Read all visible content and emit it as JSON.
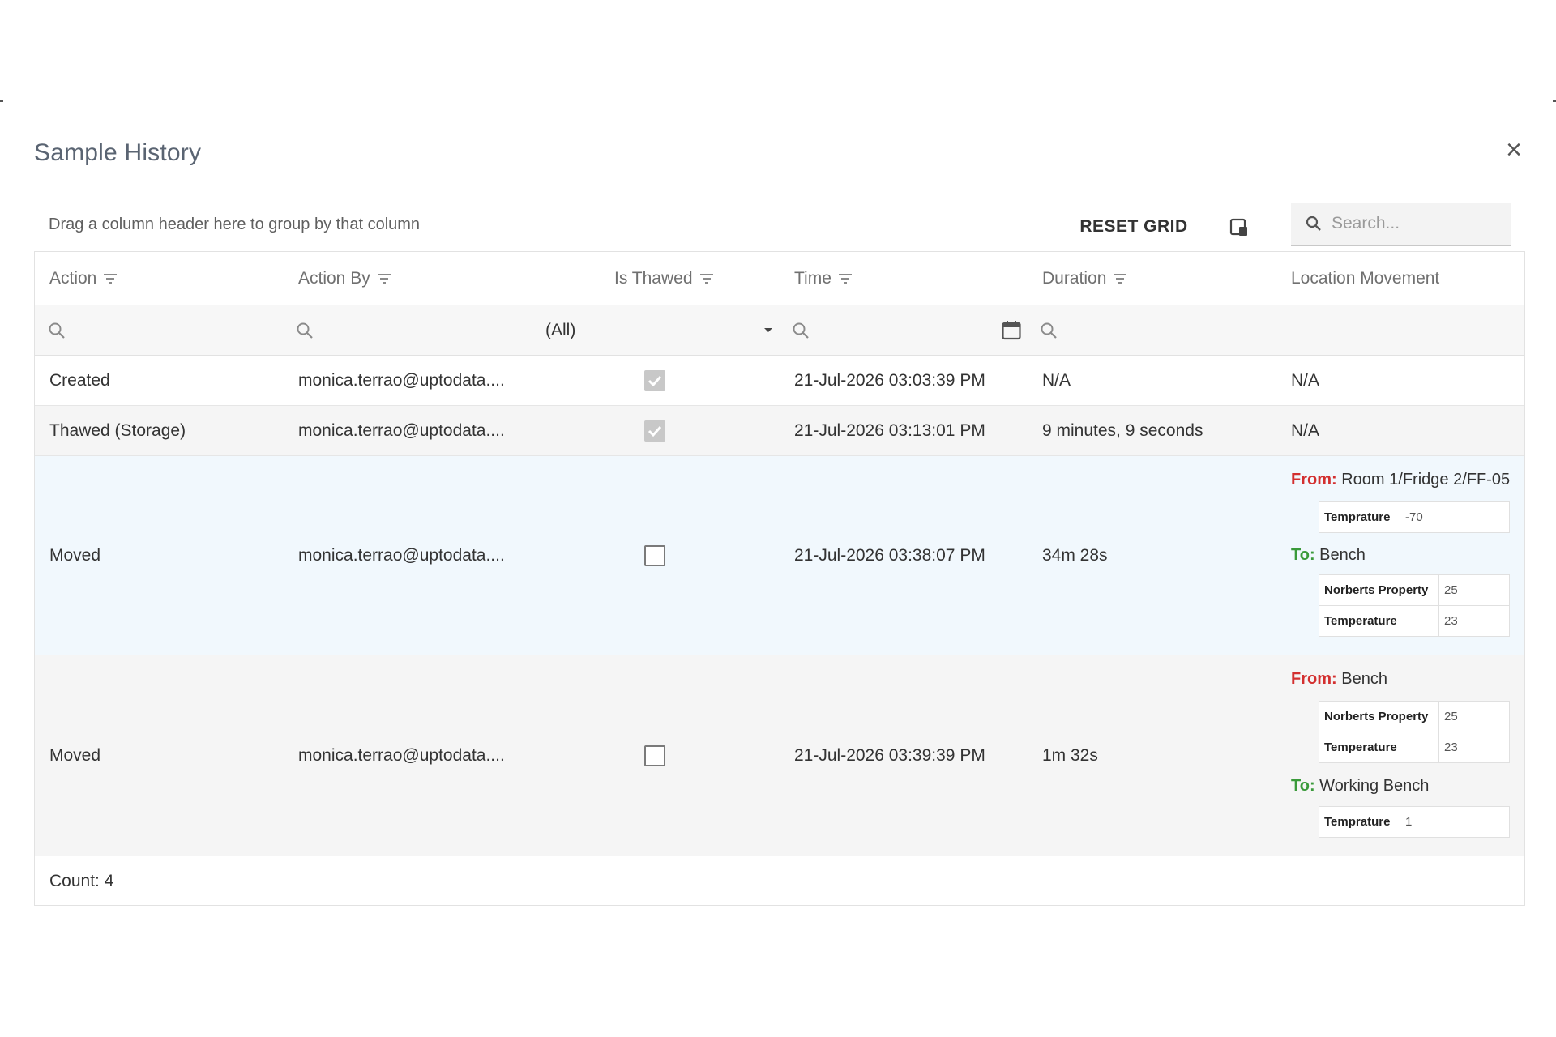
{
  "dialog": {
    "title": "Sample History",
    "close_glyph": "×"
  },
  "toolbar": {
    "group_hint": "Drag a column header here to group by that column",
    "reset_label": "RESET GRID",
    "column_chooser_icon": "column-chooser-icon",
    "search_placeholder": "Search..."
  },
  "columns": {
    "action": "Action",
    "action_by": "Action By",
    "is_thawed": "Is Thawed",
    "time": "Time",
    "duration": "Duration",
    "location": "Location Movement"
  },
  "filters": {
    "is_thawed_value": "(All)"
  },
  "rows": [
    {
      "action": "Created",
      "action_by": "monica.terrao@uptodata....",
      "is_thawed": true,
      "time": "21-Jul-2026 03:03:39 PM",
      "duration": "N/A",
      "location_text": "N/A"
    },
    {
      "action": "Thawed (Storage)",
      "action_by": "monica.terrao@uptodata....",
      "is_thawed": true,
      "time": "21-Jul-2026 03:13:01 PM",
      "duration": "9 minutes, 9 seconds",
      "location_text": "N/A"
    },
    {
      "action": "Moved",
      "action_by": "monica.terrao@uptodata....",
      "is_thawed": false,
      "time": "21-Jul-2026 03:38:07 PM",
      "duration": "34m 28s",
      "from_label": "From:",
      "from_value": "Room 1/Fridge 2/FF-05",
      "from_props": [
        {
          "key": "Temprature",
          "value": "-70"
        }
      ],
      "to_label": "To:",
      "to_value": "Bench",
      "to_props": [
        {
          "key": "Norberts Property",
          "value": "25"
        },
        {
          "key": "Temperature",
          "value": "23"
        }
      ]
    },
    {
      "action": "Moved",
      "action_by": "monica.terrao@uptodata....",
      "is_thawed": false,
      "time": "21-Jul-2026 03:39:39 PM",
      "duration": "1m 32s",
      "from_label": "From:",
      "from_value": "Bench",
      "from_props": [
        {
          "key": "Norberts Property",
          "value": "25"
        },
        {
          "key": "Temperature",
          "value": "23"
        }
      ],
      "to_label": "To:",
      "to_value": "Working Bench",
      "to_props": [
        {
          "key": "Temprature",
          "value": "1"
        }
      ]
    }
  ],
  "footer": {
    "count_label": "Count: 4"
  },
  "colors": {
    "from": "#d32f2f",
    "to": "#3a9a3a",
    "selected_row": "#f1f8fd",
    "alt_row": "#f5f5f5"
  }
}
